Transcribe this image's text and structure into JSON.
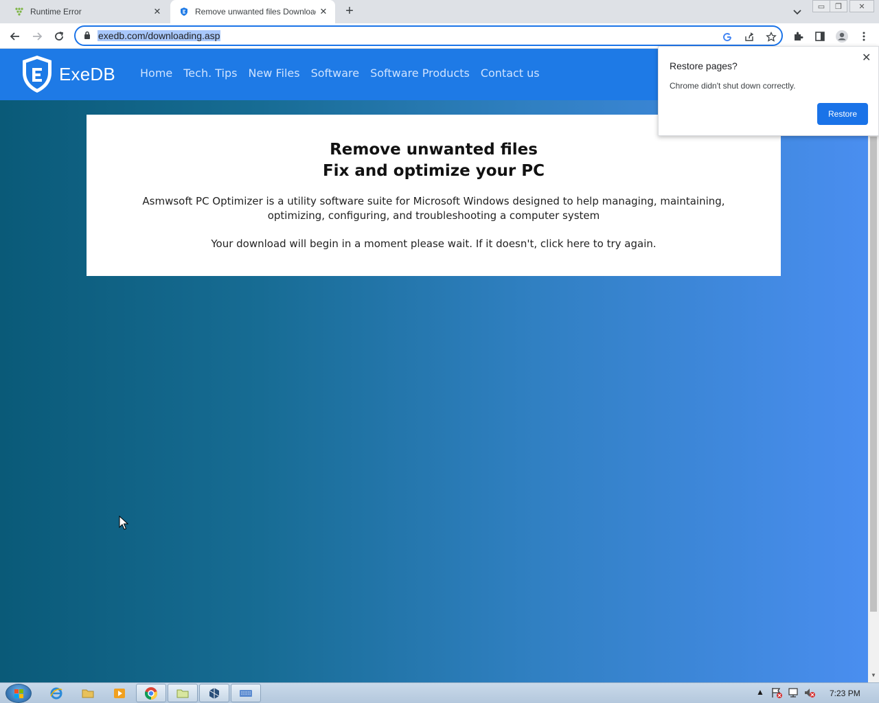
{
  "browser": {
    "tabs": [
      {
        "title": "Runtime Error",
        "active": false,
        "favicon": "runtime-error-icon"
      },
      {
        "title": "Remove unwanted files Download",
        "active": true,
        "favicon": "exedb-shield-icon"
      }
    ],
    "url": "exedb.com/downloading.asp"
  },
  "site": {
    "logo_text": "ExeDB",
    "nav": [
      "Home",
      "Tech. Tips",
      "New Files",
      "Software",
      "Software Products",
      "Contact us"
    ]
  },
  "card": {
    "heading_line1": "Remove unwanted files",
    "heading_line2": "Fix and optimize your PC",
    "description": "Asmwsoft PC Optimizer is a utility software suite for Microsoft Windows designed to help managing, maintaining, optimizing, configuring, and troubleshooting a computer system",
    "wait_text": "Your download will begin in a moment please wait. If it doesn't, click here to try again."
  },
  "restore_popup": {
    "title": "Restore pages?",
    "message": "Chrome didn't shut down correctly.",
    "button": "Restore"
  },
  "taskbar": {
    "clock": "7:23 PM"
  },
  "colors": {
    "accent": "#1a73e8",
    "site_nav": "#1e7ae6",
    "page_gradient_start": "#0a5a78",
    "page_gradient_end": "#4a8ef0"
  }
}
